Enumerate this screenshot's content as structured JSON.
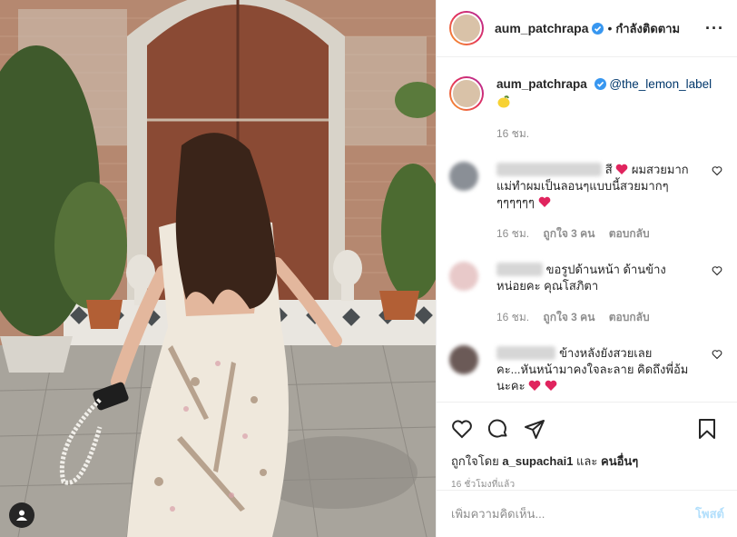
{
  "header": {
    "username": "aum_patchrapa",
    "follow_status": "กำลังติดตาม"
  },
  "caption": {
    "username": "aum_patchrapa",
    "mention": "@the_lemon_label",
    "time": "16 ชม."
  },
  "comments": [
    {
      "text_before": "สี",
      "text_after": "ผมสวยมาก แม่ทำผมเป็นลอนๆแบบนี้สวยมากๆๆๆๆๆๆๆ",
      "time": "16 ชม.",
      "likes": "ถูกใจ 3 คน",
      "reply": "ตอบกลับ",
      "avatar_color": "#8a8f96"
    },
    {
      "text_before": "ขอรูปด้านหน้า ด้านข้างหน่อยคะ คุณโสภิตา",
      "time": "16 ชม.",
      "likes": "ถูกใจ 3 คน",
      "reply": "ตอบกลับ",
      "avatar_color": "#e8c9c9"
    },
    {
      "text_before": "ข้างหลังยังสวยเลย คะ...หันหน้ามาคงใจละลาย คิดถึงพี่อ้มนะคะ",
      "avatar_color": "#6b5a57"
    }
  ],
  "likes_line": {
    "prefix": "ถูกใจโดย",
    "user": "a_supachai1",
    "and": "และ",
    "others": "คนอื่นๆ"
  },
  "posted_time": "16 ชั่วโมงที่แล้ว",
  "add_comment": {
    "placeholder": "เพิ่มความคิดเห็น...",
    "post_label": "โพสต์"
  },
  "colors": {
    "link_blue": "#00376b",
    "muted": "#8e8e8e",
    "post_disabled": "#b2dffc",
    "verified": "#3897f0",
    "heart_red": "#ed4956"
  }
}
